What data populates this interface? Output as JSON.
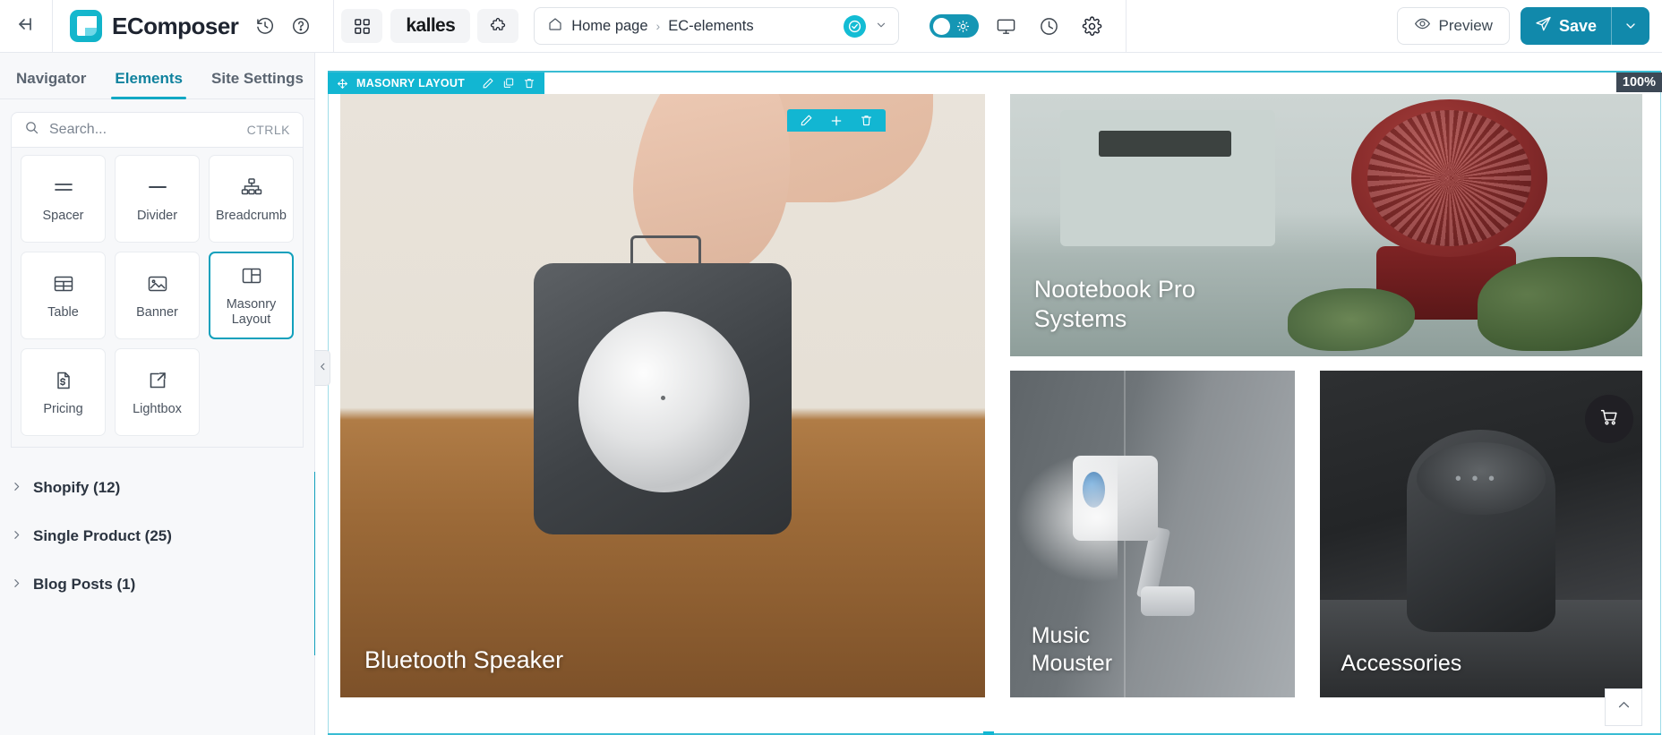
{
  "topbar": {
    "back_icon": "back-arrow-icon",
    "brand": "EComposer",
    "history_icon": "history-icon",
    "help_icon": "help-circle-icon",
    "apps_icon": "grid-apps-icon",
    "theme_name": "kalles",
    "puzzle_icon": "puzzle-icon",
    "breadcrumb": {
      "home_icon": "home-icon",
      "items": [
        "Home page",
        "EC-elements"
      ],
      "separator": "›",
      "status_icon": "check-circle-icon",
      "caret_icon": "chevron-down-icon"
    },
    "mode_toggle": {
      "state": "on",
      "icon": "sun-icon"
    },
    "desktop_icon": "desktop-monitor-icon",
    "history_clock_icon": "clock-icon",
    "settings_icon": "gear-icon",
    "preview_label": "Preview",
    "preview_icon": "eye-icon",
    "save_label": "Save",
    "save_icon": "paper-plane-icon",
    "save_caret_icon": "chevron-down-icon",
    "accent_color": "#1189ab",
    "teal_color": "#12b6d2"
  },
  "sidebar": {
    "tabs": [
      {
        "label": "Navigator",
        "active": false
      },
      {
        "label": "Elements",
        "active": true
      },
      {
        "label": "Site Settings",
        "active": false
      }
    ],
    "search": {
      "placeholder": "Search...",
      "icon": "search-icon",
      "shortcut": "CTRLK"
    },
    "elements": [
      {
        "label": "Spacer",
        "icon": "spacer-icon",
        "selected": false
      },
      {
        "label": "Divider",
        "icon": "divider-icon",
        "selected": false
      },
      {
        "label": "Breadcrumb",
        "icon": "breadcrumb-icon",
        "selected": false
      },
      {
        "label": "Table",
        "icon": "table-icon",
        "selected": false
      },
      {
        "label": "Banner",
        "icon": "banner-icon",
        "selected": false
      },
      {
        "label": "Masonry\nLayout",
        "icon": "masonry-icon",
        "selected": true
      },
      {
        "label": "Pricing",
        "icon": "pricing-icon",
        "selected": false
      },
      {
        "label": "Lightbox",
        "icon": "lightbox-icon",
        "selected": false
      }
    ],
    "sections": [
      {
        "label": "Shopify (12)",
        "chevron": "chevron-right-icon"
      },
      {
        "label": "Single Product (25)",
        "chevron": "chevron-right-icon"
      },
      {
        "label": "Blog Posts (1)",
        "chevron": "chevron-right-icon"
      }
    ],
    "collapse_icon": "chevron-left-icon"
  },
  "canvas": {
    "section_toolbar": {
      "edit_icon": "pencil-icon",
      "add_icon": "plus-icon",
      "delete_icon": "trash-icon"
    },
    "element_badge": {
      "move_icon": "move-cross-icon",
      "label": "MASONRY LAYOUT",
      "edit_icon": "pencil-icon",
      "duplicate_icon": "copy-icon",
      "delete_icon": "trash-icon"
    },
    "zoom_level": "100%",
    "cart_icon": "shopping-cart-icon",
    "scroll_top_icon": "chevron-up-icon",
    "masonry_tiles": [
      {
        "title": "Bluetooth Speaker",
        "position": "large-left"
      },
      {
        "title": "Nootebook Pro\nSystems",
        "position": "top-right"
      },
      {
        "title": "Music\nMouster",
        "position": "bottom-mid"
      },
      {
        "title": "Accessories",
        "position": "bottom-right"
      }
    ]
  }
}
